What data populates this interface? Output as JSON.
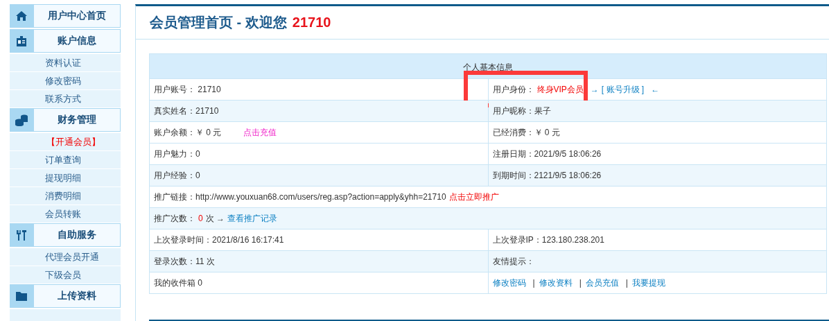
{
  "sidebar": [
    {
      "title": "用户中心首页"
    },
    {
      "title": "账户信息",
      "items": [
        {
          "label": "资料认证",
          "highlighted": false
        },
        {
          "label": "修改密码",
          "highlighted": false
        },
        {
          "label": "联系方式",
          "highlighted": false
        }
      ]
    },
    {
      "title": "财务管理",
      "items": [
        {
          "label": "【开通会员】",
          "highlighted": true
        },
        {
          "label": "订单查询",
          "highlighted": false
        },
        {
          "label": "提现明细",
          "highlighted": false
        },
        {
          "label": "消费明细",
          "highlighted": false
        },
        {
          "label": "会员转账",
          "highlighted": false
        }
      ]
    },
    {
      "title": "自助服务",
      "items": [
        {
          "label": "代理会员开通",
          "highlighted": false
        },
        {
          "label": "下级会员",
          "highlighted": false
        }
      ]
    },
    {
      "title": "上传资料"
    }
  ],
  "page_title": {
    "text": "会员管理首页 - 欢迎您",
    "username": "21710"
  },
  "table": {
    "caption": "个人基本信息",
    "rows": [
      {
        "shaded": false,
        "cells": [
          {
            "parts": [
              {
                "kind": "plain",
                "text": "用户账号： 21710"
              }
            ]
          },
          {
            "highlighted": true,
            "parts": [
              {
                "kind": "plain",
                "text": "用户身份："
              },
              {
                "kind": "alert",
                "text": "终身VIP会员"
              },
              {
                "kind": "arrow",
                "text": "→"
              },
              {
                "kind": "link",
                "text": "[ 账号升级 ]"
              },
              {
                "kind": "arrow",
                "text": "←"
              }
            ]
          }
        ]
      },
      {
        "shaded": true,
        "cells": [
          {
            "parts": [
              {
                "kind": "plain",
                "text": "真实姓名：21710"
              }
            ]
          },
          {
            "parts": [
              {
                "kind": "plain",
                "text": "用户昵称：果子"
              }
            ]
          }
        ]
      },
      {
        "shaded": false,
        "cells": [
          {
            "parts": [
              {
                "kind": "plain",
                "text": "账户余额：￥ 0 元"
              },
              {
                "kind": "pink-link",
                "text": "点击充值"
              }
            ]
          },
          {
            "parts": [
              {
                "kind": "plain",
                "text": "已经消费：￥ 0 元"
              }
            ]
          }
        ]
      },
      {
        "shaded": false,
        "cells": [
          {
            "parts": [
              {
                "kind": "plain",
                "text": "用户魅力：0"
              }
            ]
          },
          {
            "parts": [
              {
                "kind": "plain",
                "text": "注册日期：2021/9/5 18:06:26"
              }
            ]
          }
        ]
      },
      {
        "shaded": true,
        "cells": [
          {
            "parts": [
              {
                "kind": "plain",
                "text": "用户经验：0"
              }
            ]
          },
          {
            "parts": [
              {
                "kind": "plain",
                "text": "到期时间：2121/9/5 18:06:26"
              }
            ]
          }
        ]
      },
      {
        "shaded": false,
        "cells": [
          {
            "colspan": 2,
            "parts": [
              {
                "kind": "plain",
                "text": "推广链接：http://www.youxuan68.com/users/reg.asp?action=apply&yhh=21710"
              },
              {
                "kind": "red-link",
                "text": "点击立即推广"
              }
            ]
          }
        ]
      },
      {
        "shaded": true,
        "cells": [
          {
            "colspan": 2,
            "parts": [
              {
                "kind": "plain",
                "text": "推广次数："
              },
              {
                "kind": "alert",
                "text": "0"
              },
              {
                "kind": "plain",
                "text": "次 →"
              },
              {
                "kind": "link",
                "text": "查看推广记录"
              }
            ]
          }
        ]
      },
      {
        "shaded": false,
        "cells": [
          {
            "parts": [
              {
                "kind": "plain",
                "text": "上次登录时间：2021/8/16 16:17:41"
              }
            ]
          },
          {
            "parts": [
              {
                "kind": "plain",
                "text": "上次登录IP：123.180.238.201"
              }
            ]
          }
        ]
      },
      {
        "shaded": true,
        "cells": [
          {
            "parts": [
              {
                "kind": "plain",
                "text": "登录次数：11 次"
              }
            ]
          },
          {
            "parts": [
              {
                "kind": "plain",
                "text": "友情提示："
              }
            ]
          }
        ]
      },
      {
        "shaded": false,
        "cells": [
          {
            "parts": [
              {
                "kind": "plain",
                "text": "我的收件箱 0"
              }
            ]
          },
          {
            "parts": [
              {
                "kind": "link",
                "text": "修改密码"
              },
              {
                "kind": "separator",
                "text": "|"
              },
              {
                "kind": "link",
                "text": "修改资料"
              },
              {
                "kind": "separator",
                "text": "|"
              },
              {
                "kind": "link",
                "text": "会员充值"
              },
              {
                "kind": "separator",
                "text": "|"
              },
              {
                "kind": "link",
                "text": "我要提现"
              }
            ]
          }
        ]
      }
    ]
  }
}
